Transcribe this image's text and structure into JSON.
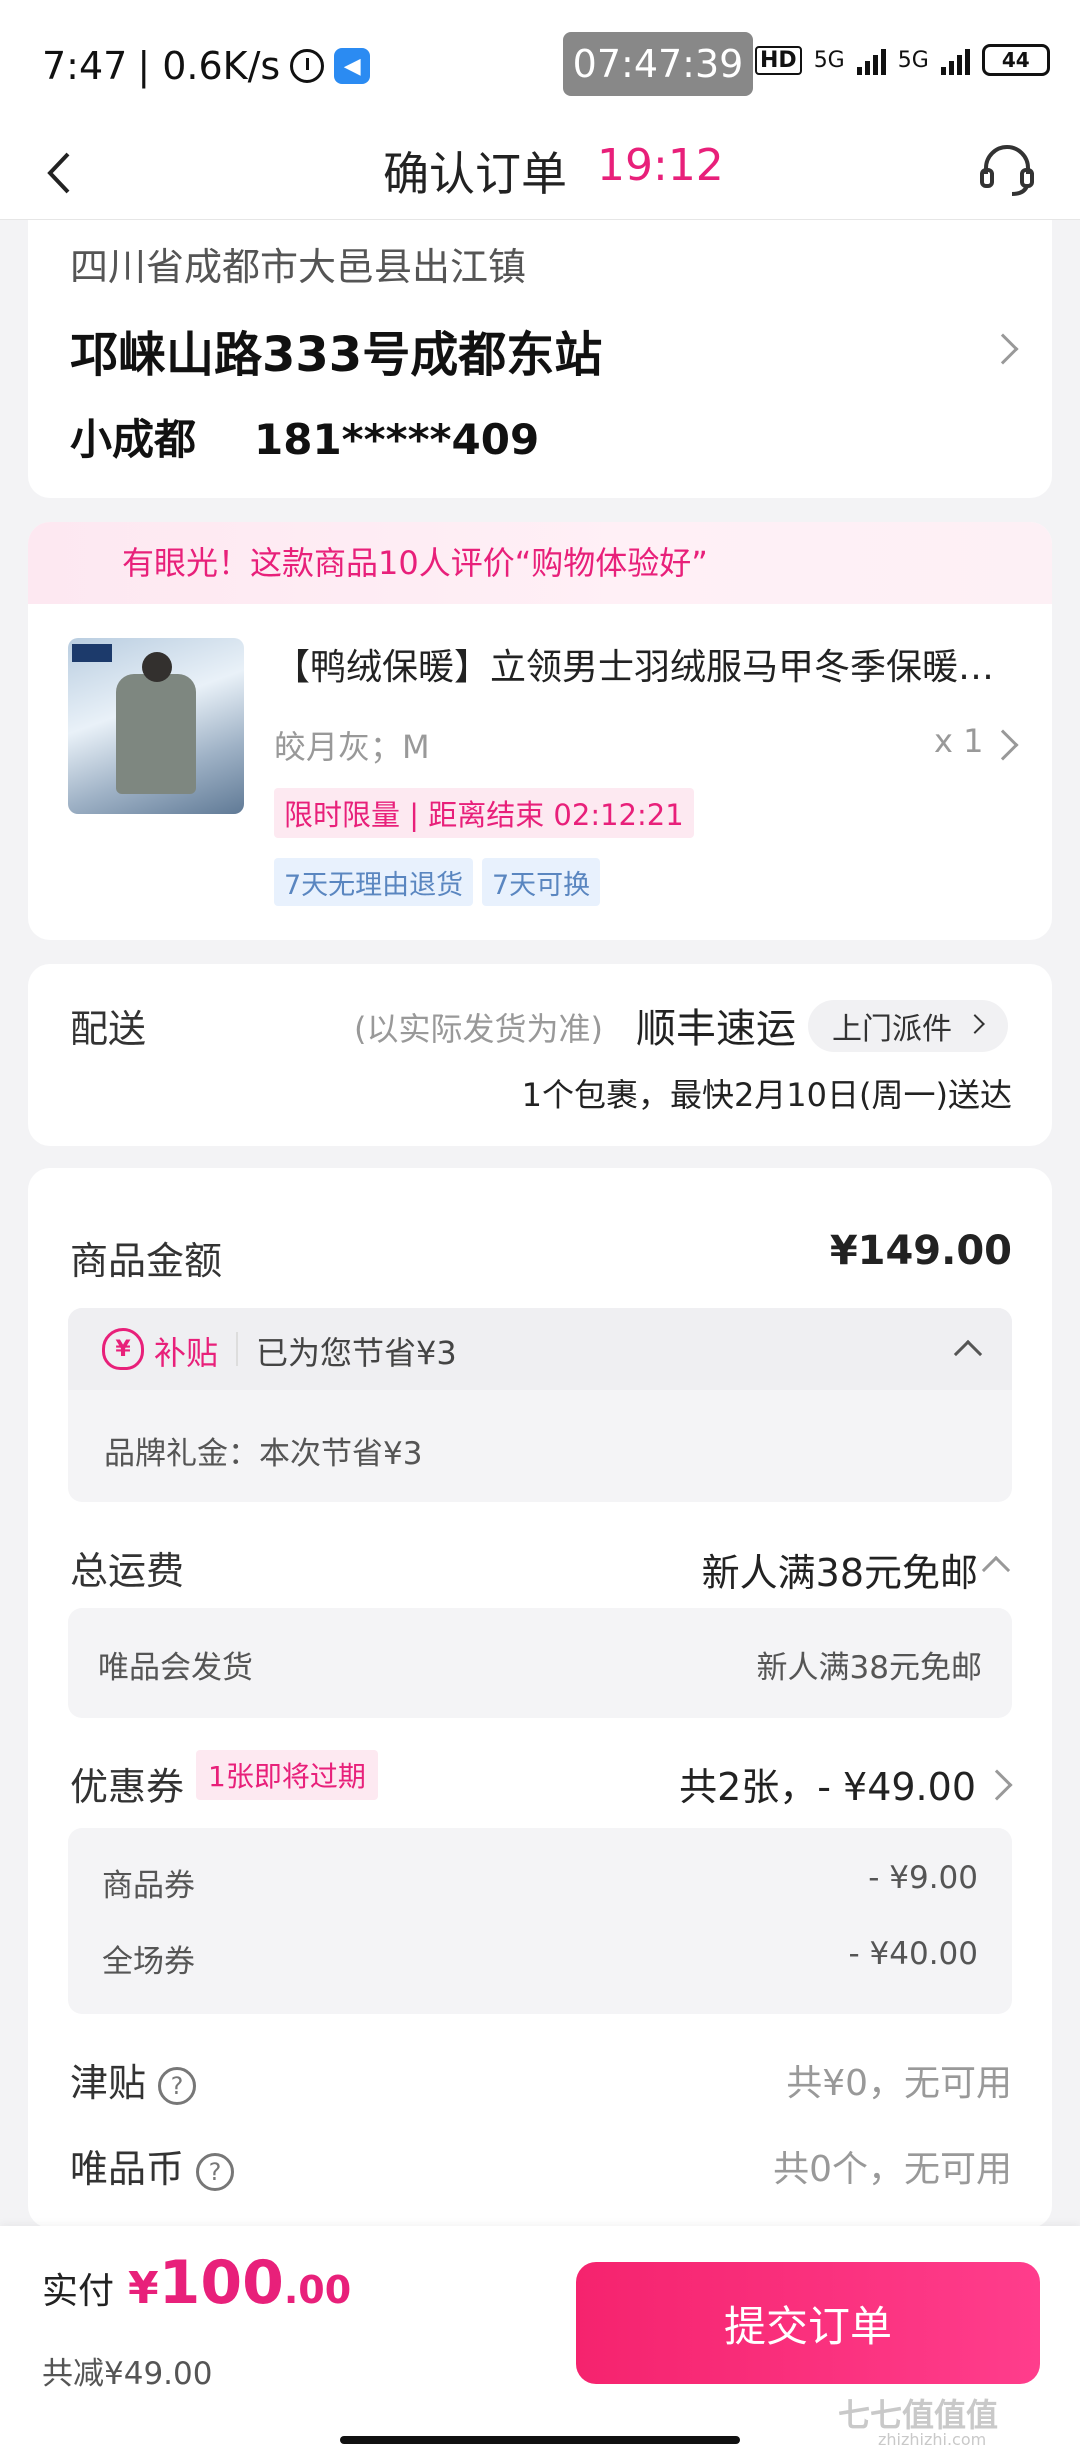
{
  "status_bar": {
    "time": "7:47",
    "net_speed": "| 0.6K/s",
    "clock_overlay": "07:47:39",
    "hd_label": "HD",
    "net1": "5G",
    "net2": "5G",
    "battery": "44"
  },
  "header": {
    "title": "确认订单",
    "countdown": "19:12"
  },
  "address": {
    "region": "四川省成都市大邑县出江镇",
    "street": "邛崃山路333号成都东站",
    "name": "小成都",
    "phone": "181*****409"
  },
  "product": {
    "praise": "有眼光！这款商品10人评价“购物体验好”",
    "title": "【鸭绒保暖】立领男士羽绒服马甲冬季保暖外套",
    "spec": "皎月灰；M",
    "qty": "x 1",
    "limit_tag": "限时限量 | 距离结束 02:12:21",
    "service_tags": [
      "7天无理由退货",
      "7天可换"
    ]
  },
  "delivery": {
    "label": "配送",
    "note": "(以实际发货为准)",
    "carrier": "顺丰速运",
    "pickup": "上门派件",
    "eta": "1个包裹，最快2月10日(周一)送达"
  },
  "pricing": {
    "goods_label": "商品金额",
    "goods_value": "¥149.00",
    "subsidy_icon": "¥",
    "subsidy_label": "补贴",
    "subsidy_saved": "已为您节省¥3",
    "brand_gift": "品牌礼金：本次节省¥3",
    "shipping_label": "总运费",
    "shipping_value": "新人满38元免邮",
    "shipper": "唯品会发货",
    "shipper_value": "新人满38元免邮",
    "coupon_label": "优惠券",
    "coupon_tag": "1张即将过期",
    "coupon_value": "共2张，- ¥49.00",
    "coupon_items": [
      {
        "label": "商品券",
        "value": "- ¥9.00"
      },
      {
        "label": "全场券",
        "value": "- ¥40.00"
      }
    ],
    "allowance_label": "津贴",
    "allowance_value": "共¥0，无可用",
    "vcoin_label": "唯品币",
    "vcoin_value": "共0个，无可用",
    "help_glyph": "?"
  },
  "footer": {
    "pay_label": "实付",
    "currency": "¥",
    "amount_int": "100",
    "amount_dec": ".00",
    "saved": "共减¥49.00",
    "submit": "提交订单"
  },
  "watermark": {
    "logo": "七七值值值",
    "url": "zhizhizhi.com"
  },
  "colors": {
    "accent": "#e8207a",
    "tag_blue_bg": "#e8f1fd",
    "tag_blue_text": "#5a86c0"
  },
  "icons": [
    "back-icon",
    "headset-icon",
    "alarm-icon",
    "chevron-right-icon",
    "chevron-up-icon",
    "help-icon",
    "subsidy-icon"
  ]
}
